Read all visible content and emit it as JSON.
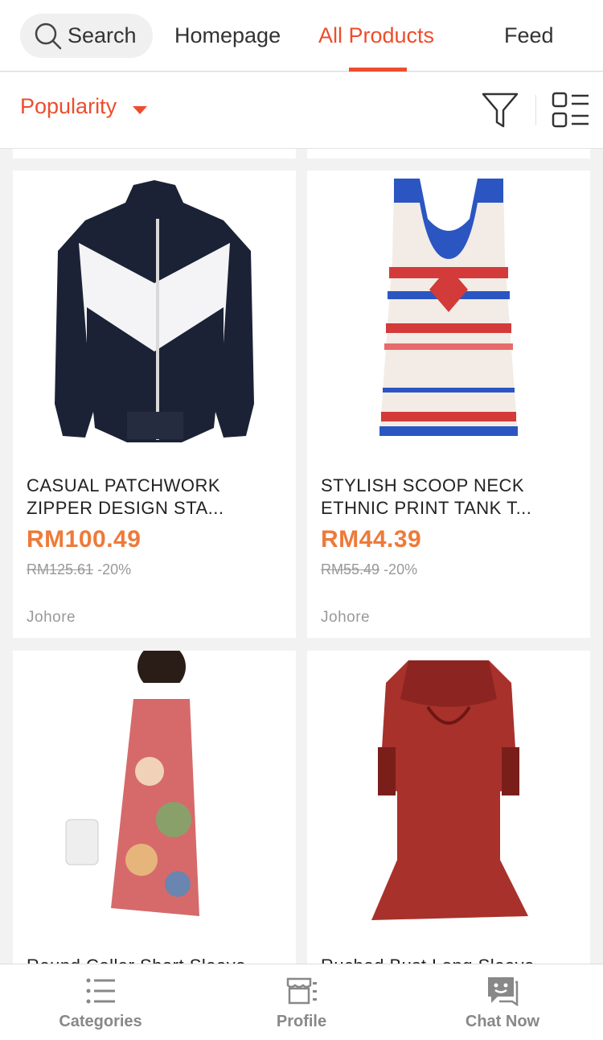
{
  "header": {
    "search_label": "Search",
    "tabs": [
      "Homepage",
      "All Products",
      "Feed"
    ],
    "active_tab": "All Products",
    "accent_color": "#ee4d2d"
  },
  "sort": {
    "label": "Popularity"
  },
  "products": [
    {
      "title_line1": "CASUAL PATCHWORK",
      "title_line2": "ZIPPER DESIGN STA...",
      "price": "RM100.49",
      "old_price": "RM125.61",
      "discount": "-20%",
      "location": "Johore"
    },
    {
      "title_line1": "STYLISH SCOOP NECK",
      "title_line2": "ETHNIC PRINT TANK T...",
      "price": "RM44.39",
      "old_price": "RM55.49",
      "discount": "-20%",
      "location": "Johore"
    },
    {
      "title_line1": "Round Collar Short Sleeve",
      "title_line2": "",
      "price": "",
      "old_price": "",
      "discount": "",
      "location": ""
    },
    {
      "title_line1": "Ruched Bust Long Sleeve",
      "title_line2": "",
      "price": "",
      "old_price": "",
      "discount": "",
      "location": ""
    }
  ],
  "bottom_nav": [
    {
      "label": "Categories",
      "icon": "list-icon"
    },
    {
      "label": "Profile",
      "icon": "shop-profile-icon"
    },
    {
      "label": "Chat Now",
      "icon": "chat-icon"
    }
  ]
}
